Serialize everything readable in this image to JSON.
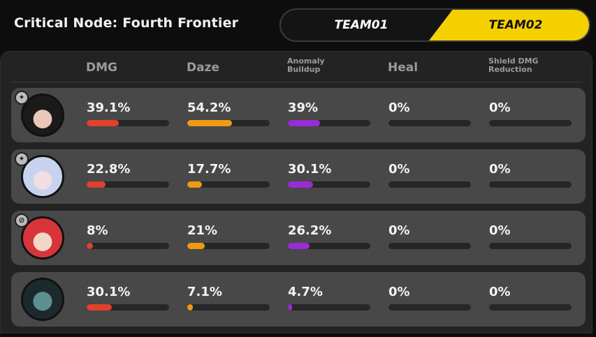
{
  "header": {
    "title": "Critical Node: Fourth Frontier",
    "tabs": [
      {
        "label": "TEAM01",
        "active": false
      },
      {
        "label": "TEAM02",
        "active": true
      }
    ]
  },
  "table": {
    "columns": [
      "DMG",
      "Daze",
      "Anomaly Buildup",
      "Heal",
      "Shield DMG Reduction"
    ],
    "column_colors": [
      "#e0412a",
      "#f09a14",
      "#9b2bd6",
      "#6a6a6a",
      "#6a6a6a"
    ],
    "rows": [
      {
        "values": [
          "39.1%",
          "54.2%",
          "39%",
          "0%",
          "0%"
        ],
        "fractions": [
          0.391,
          0.542,
          0.39,
          0,
          0
        ]
      },
      {
        "values": [
          "22.8%",
          "17.7%",
          "30.1%",
          "0%",
          "0%"
        ],
        "fractions": [
          0.228,
          0.177,
          0.301,
          0,
          0
        ]
      },
      {
        "values": [
          "8%",
          "21%",
          "26.2%",
          "0%",
          "0%"
        ],
        "fractions": [
          0.08,
          0.21,
          0.262,
          0,
          0
        ]
      },
      {
        "values": [
          "30.1%",
          "7.1%",
          "4.7%",
          "0%",
          "0%"
        ],
        "fractions": [
          0.301,
          0.071,
          0.047,
          0,
          0
        ]
      }
    ]
  },
  "colors": {
    "accent": "#f5d000",
    "panel": "#232323",
    "row": "#484848"
  }
}
